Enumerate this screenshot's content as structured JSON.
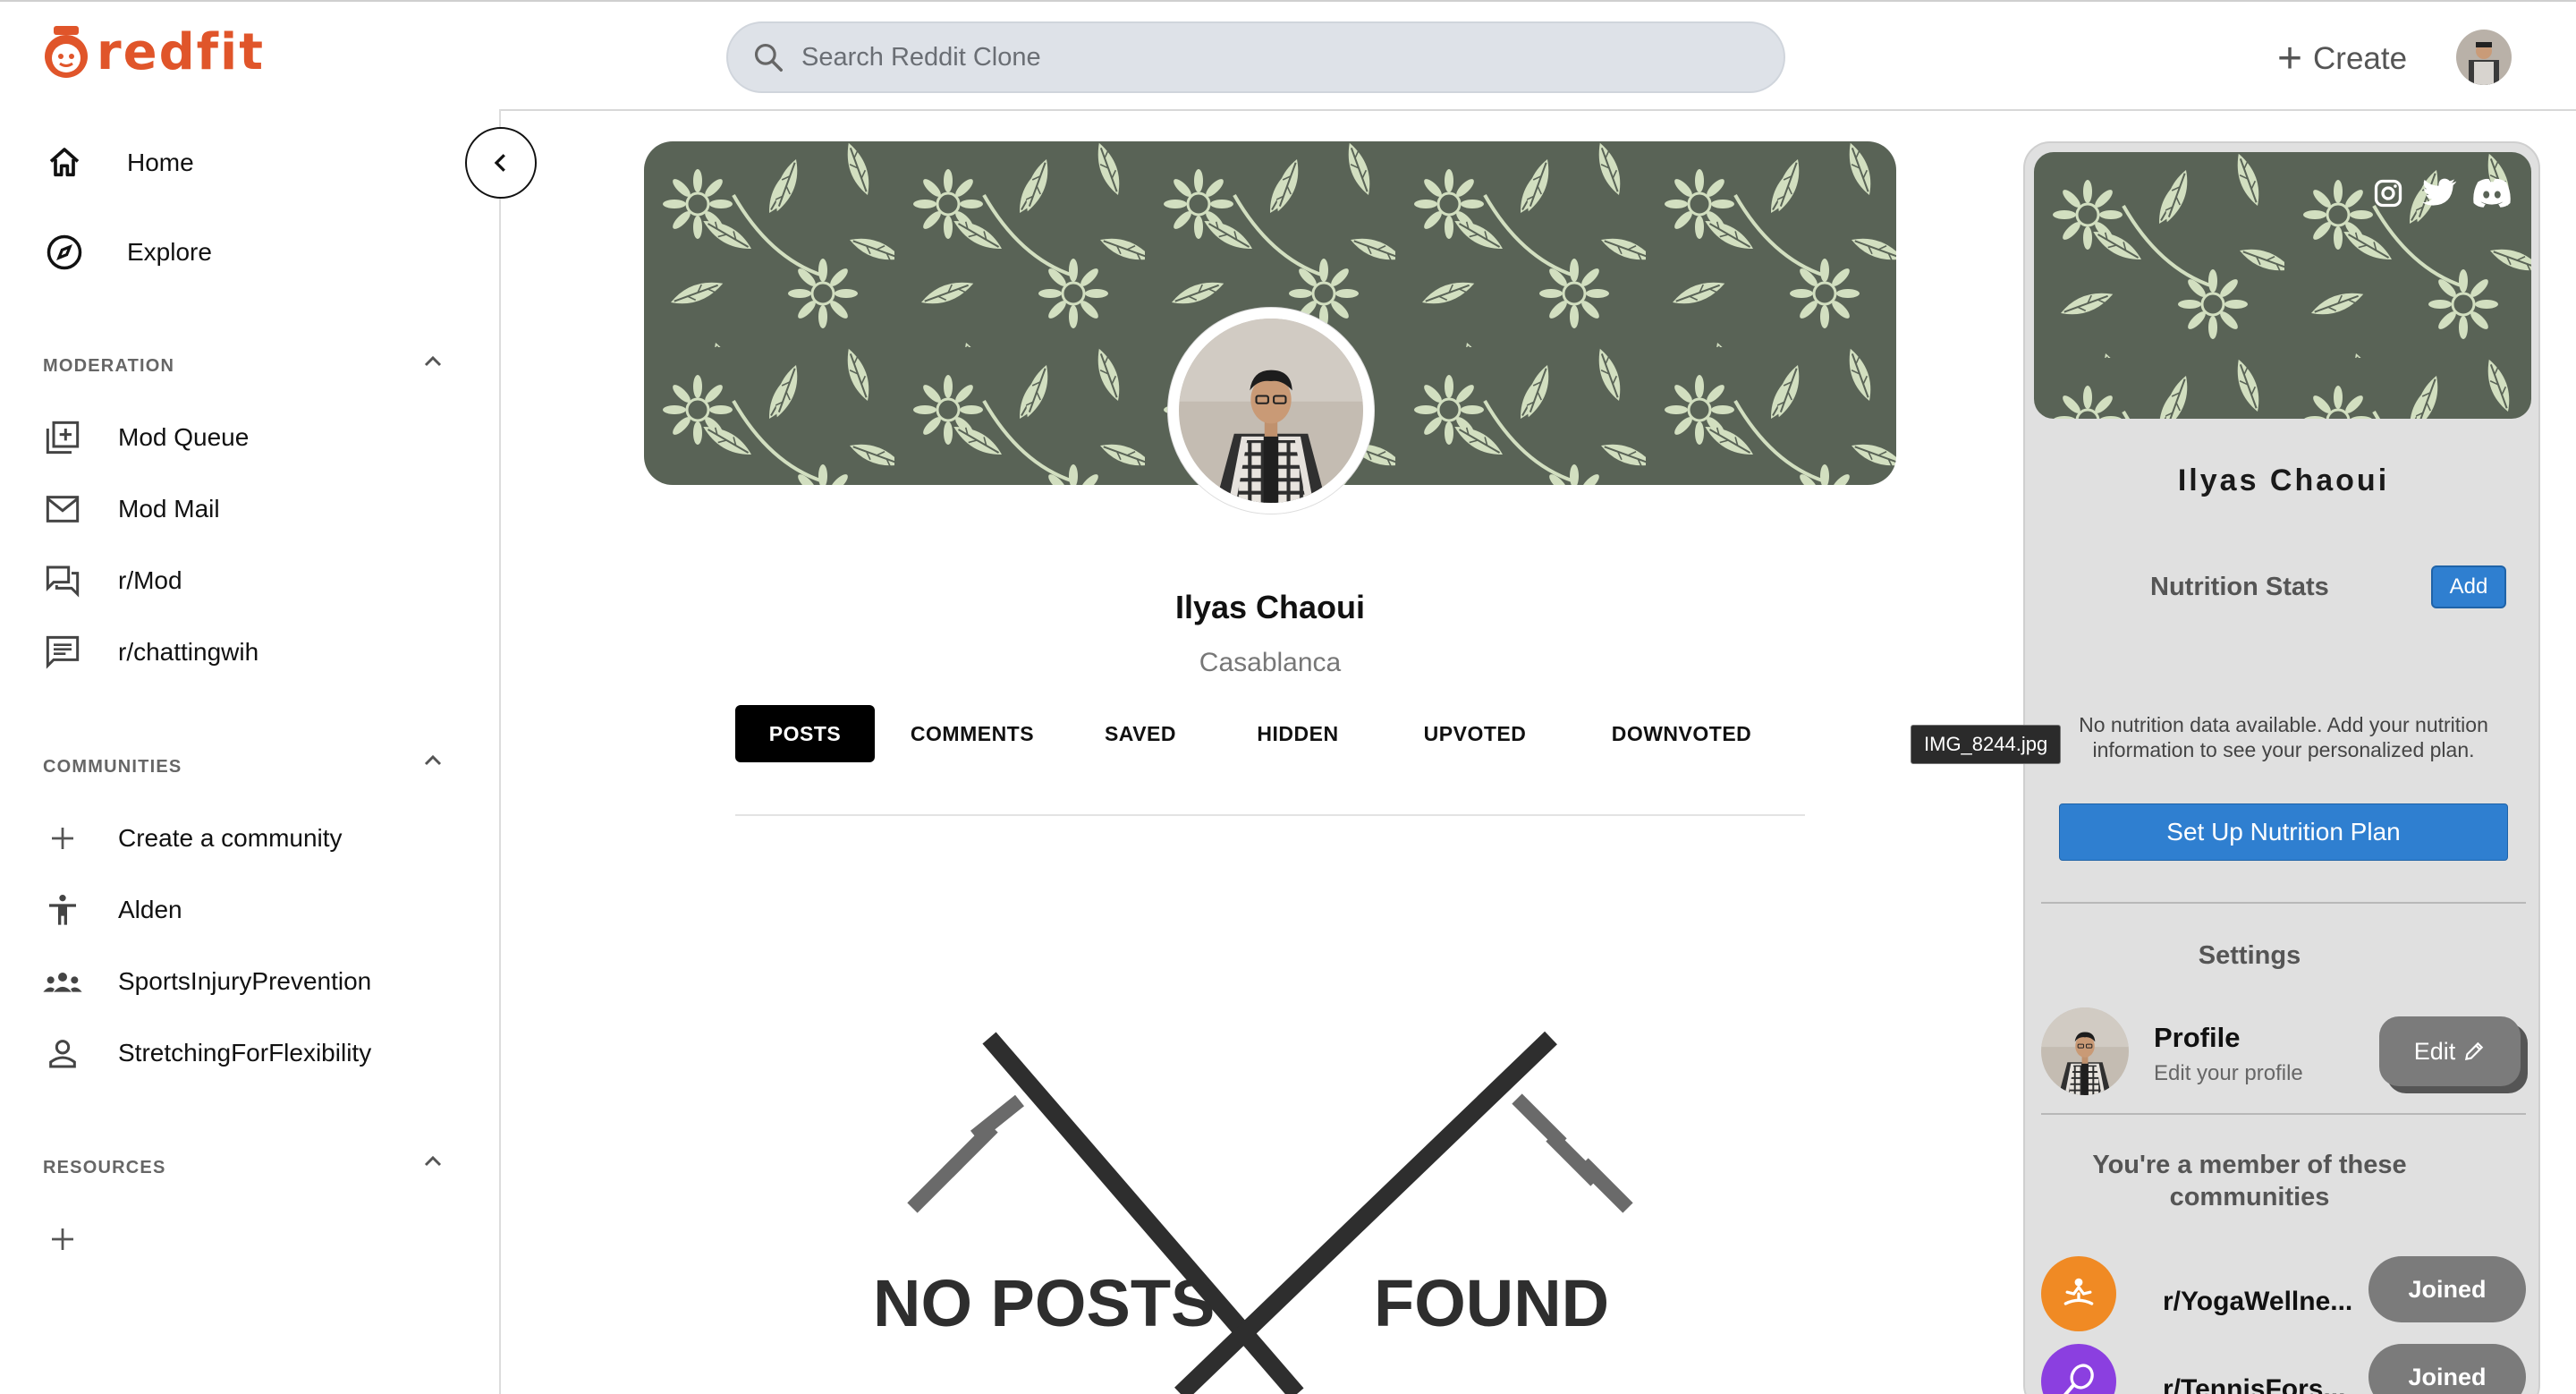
{
  "app": {
    "logo_text": "redfit",
    "brand_color": "#e0552a"
  },
  "header": {
    "search_placeholder": "Search Reddit Clone",
    "create_label": "Create"
  },
  "sidebar": {
    "main": [
      {
        "label": "Home",
        "icon": "home-icon"
      },
      {
        "label": "Explore",
        "icon": "compass-icon"
      }
    ],
    "moderation": {
      "title": "MODERATION",
      "items": [
        {
          "label": "Mod Queue",
          "icon": "mod-queue-icon"
        },
        {
          "label": "Mod Mail",
          "icon": "mail-icon"
        },
        {
          "label": "r/Mod",
          "icon": "chat-icon"
        },
        {
          "label": "r/chattingwih",
          "icon": "message-icon"
        }
      ]
    },
    "communities": {
      "title": "COMMUNITIES",
      "items": [
        {
          "label": "Create a community",
          "icon": "plus-icon"
        },
        {
          "label": "Alden",
          "icon": "accessibility-icon"
        },
        {
          "label": "SportsInjuryPrevention",
          "icon": "groups-icon"
        },
        {
          "label": "StretchingForFlexibility",
          "icon": "person-icon"
        }
      ]
    },
    "resources": {
      "title": "RESOURCES"
    }
  },
  "profile": {
    "name": "Ilyas Chaoui",
    "location": "Casablanca",
    "tabs": [
      "POSTS",
      "COMMENTS",
      "SAVED",
      "HIDDEN",
      "UPVOTED",
      "DOWNVOTED"
    ],
    "active_tab": "POSTS",
    "tooltip": "IMG_8244.jpg",
    "empty_state": {
      "left": "NO POSTS",
      "right": "FOUND"
    }
  },
  "right_panel": {
    "name": "Ilyas Chaoui",
    "nutrition_title": "Nutrition Stats",
    "add_label": "Add",
    "no_data_text": "No nutrition data available. Add your nutrition information to see your personalized plan.",
    "setup_label": "Set Up Nutrition Plan",
    "settings_title": "Settings",
    "profile_label": "Profile",
    "profile_sub": "Edit your profile",
    "edit_label": "Edit",
    "member_title": "You're a member of these communities",
    "communities": [
      {
        "name": "r/YogaWellne...",
        "join_label": "Joined",
        "color": "#f08a24",
        "icon": "meditation-icon"
      },
      {
        "name": "r/TennisFors...",
        "join_label": "Joined",
        "color": "#8b3fe0",
        "icon": "tennis-racket-icon"
      }
    ]
  },
  "colors": {
    "banner_bg": "#596356",
    "banner_leaf": "#d2dfc0",
    "primary_button": "#2f7fd0"
  }
}
